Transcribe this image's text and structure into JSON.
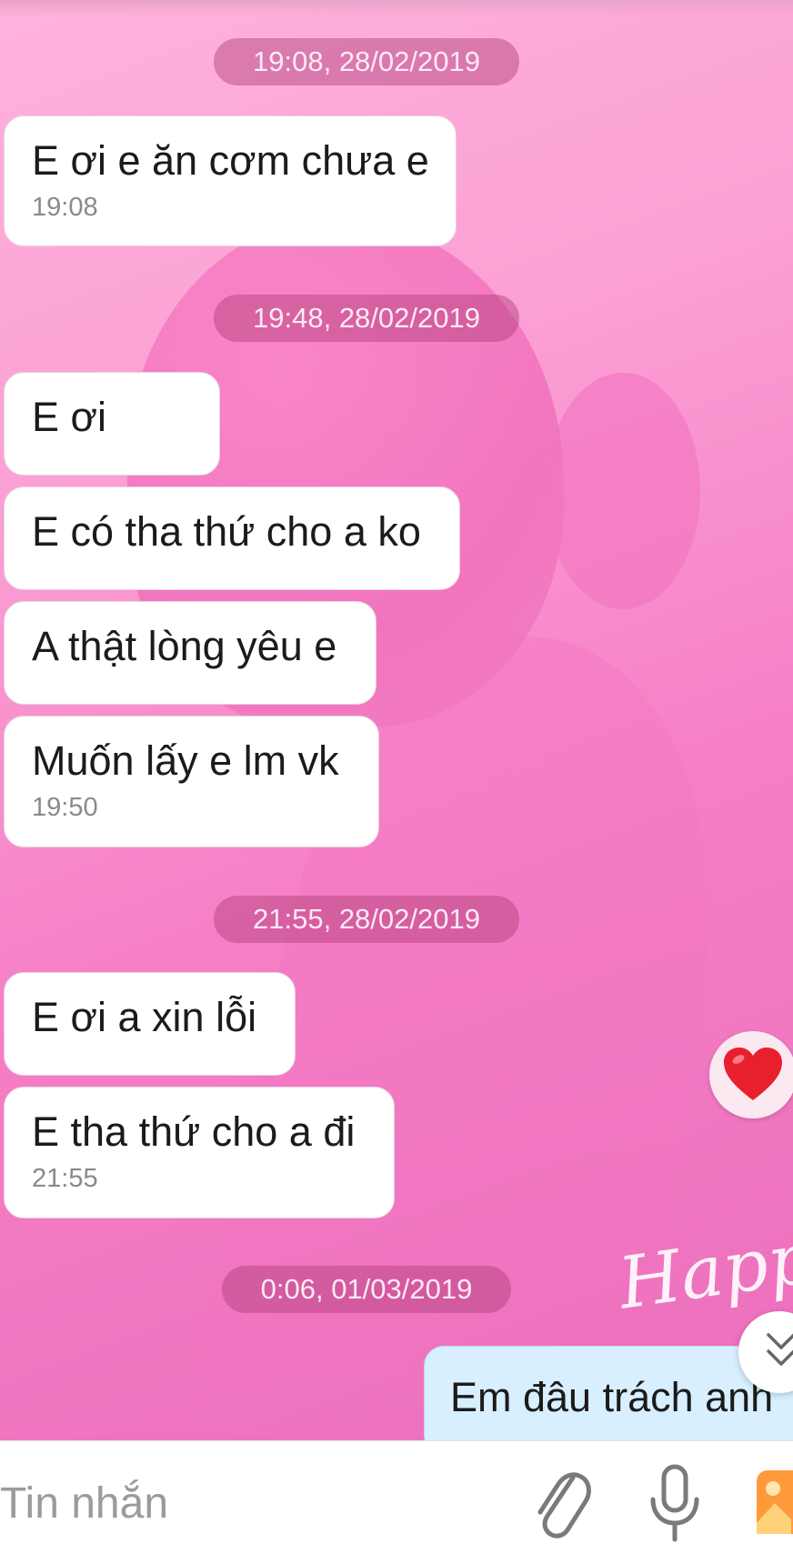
{
  "conversation": {
    "groups": [
      {
        "date_label": "19:08, 28/02/2019",
        "messages": [
          {
            "text": "E ơi e ăn cơm chưa e",
            "time": "19:08"
          }
        ]
      },
      {
        "date_label": "19:48, 28/02/2019",
        "messages": [
          {
            "text": "E ơi"
          },
          {
            "text": "E có tha thứ cho a ko"
          },
          {
            "text": "A thật lòng yêu e"
          },
          {
            "text": "Muốn lấy e lm vk",
            "time": "19:50"
          }
        ]
      },
      {
        "date_label": "21:55, 28/02/2019",
        "messages": [
          {
            "text": "E ơi a xin lỗi"
          },
          {
            "text": "E tha thứ cho a đi",
            "time": "21:55"
          }
        ]
      },
      {
        "date_label": "0:06, 01/03/2019",
        "outgoing": {
          "text": "Em đâu trách anh"
        }
      }
    ]
  },
  "background": {
    "decoration_text": "Happy"
  },
  "input_bar": {
    "placeholder": "Tin nhắn",
    "icons": [
      "attach-icon",
      "microphone-icon",
      "gallery-icon"
    ]
  },
  "colors": {
    "incoming_bubble": "#ffffff",
    "outgoing_bubble": "#d7efff",
    "date_pill": "#b03c78"
  }
}
